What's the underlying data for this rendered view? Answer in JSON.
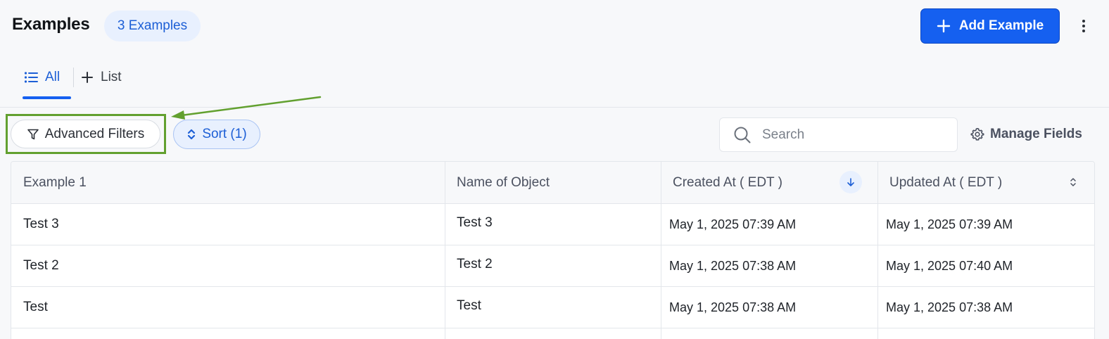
{
  "header": {
    "title": "Examples",
    "count_badge": "3 Examples",
    "add_button_label": "Add Example"
  },
  "tabs": [
    {
      "label": "All",
      "icon": "list-icon",
      "active": true
    },
    {
      "label": "List",
      "icon": "plus-icon",
      "active": false
    }
  ],
  "toolbar": {
    "advanced_filters_label": "Advanced Filters",
    "sort_label": "Sort (1)",
    "search_placeholder": "Search",
    "search_value": "",
    "manage_fields_label": "Manage Fields"
  },
  "table": {
    "columns": [
      {
        "label": "Example 1"
      },
      {
        "label": "Name of Object"
      },
      {
        "label": "Created At ( EDT )",
        "sort": "descending"
      },
      {
        "label": "Updated At ( EDT )",
        "sort": "none"
      }
    ],
    "rows": [
      {
        "example": "Test 3",
        "name": "Test 3",
        "created": "May 1, 2025 07:39 AM",
        "updated": "May 1, 2025 07:39 AM"
      },
      {
        "example": "Test 2",
        "name": "Test 2",
        "created": "May 1, 2025 07:38 AM",
        "updated": "May 1, 2025 07:40 AM"
      },
      {
        "example": "Test",
        "name": "Test",
        "created": "May 1, 2025 07:38 AM",
        "updated": "May 1, 2025 07:38 AM"
      }
    ]
  },
  "colors": {
    "accent": "#1560f0",
    "annotation": "#62a02f"
  }
}
